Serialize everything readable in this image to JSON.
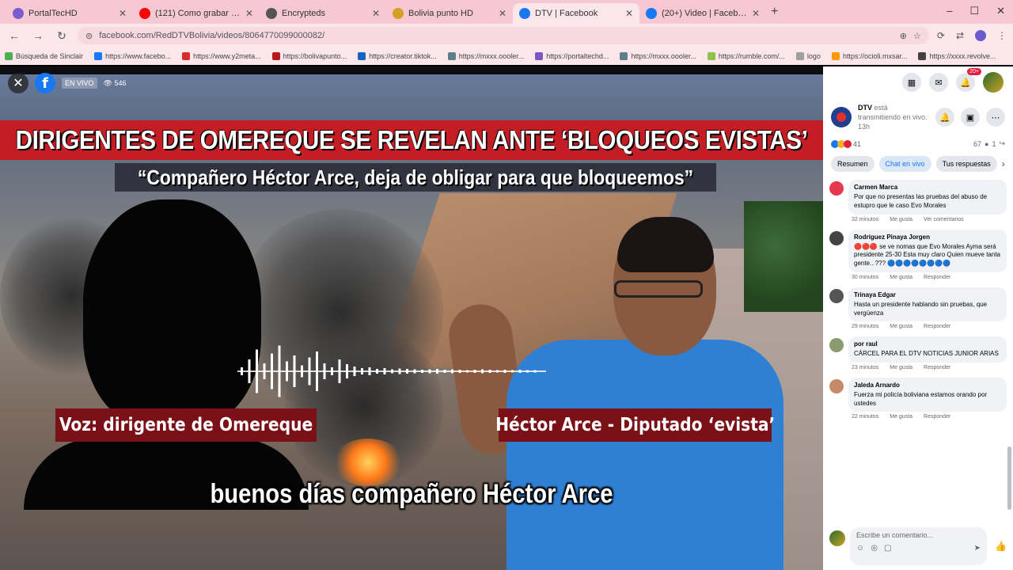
{
  "browser": {
    "tabs": [
      {
        "title": "PortalTecHD",
        "color": "#7a5ccf",
        "active": false
      },
      {
        "title": "(121) Como grabar la pantalla",
        "color": "#ff0000",
        "active": false
      },
      {
        "title": "Encrypteds",
        "color": "#555555",
        "active": false
      },
      {
        "title": "Bolivia punto HD",
        "color": "#d4a020",
        "active": false
      },
      {
        "title": "DTV | Facebook",
        "color": "#1877f2",
        "active": true
      },
      {
        "title": "(20+) Video | Facebook",
        "color": "#1877f2",
        "active": false
      }
    ],
    "url": "facebook.com/RedDTVBolivia/videos/8064770099000082/",
    "bookmarks": [
      {
        "label": "Búsqueda de Sinclair",
        "color": "#4caf50"
      },
      {
        "label": "https://www.facebo...",
        "color": "#1877f2"
      },
      {
        "label": "https://www.y2meta...",
        "color": "#d32f2f"
      },
      {
        "label": "https://bolivapunto...",
        "color": "#b71c1c"
      },
      {
        "label": "https://creator.tiktok...",
        "color": "#1565c0"
      },
      {
        "label": "https://mxxx.oooler...",
        "color": "#607d8b"
      },
      {
        "label": "https://portaltechd...",
        "color": "#7e57c2"
      },
      {
        "label": "https://mxxx.oooler...",
        "color": "#607d8b"
      },
      {
        "label": "https://rumble.com/...",
        "color": "#8bc34a"
      },
      {
        "label": "logo",
        "color": "#9e9e9e"
      },
      {
        "label": "https://ocioli.mxsar...",
        "color": "#ff9800"
      },
      {
        "label": "https://xxxx.revolve...",
        "color": "#424242"
      }
    ]
  },
  "video": {
    "views": "546",
    "badge": "EN VIVO",
    "title_banner": "DIRIGENTES DE OMEREQUE SE REVELAN ANTE ‘BLOQUEOS EVISTAS’",
    "subtitle_banner": "“Compañero Héctor Arce, deja de obligar para que bloqueemos”",
    "caption_left": "Voz: dirigente de Omereque",
    "caption_right": "Héctor Arce - Diputado ‘evista’",
    "live_caption": "buenos días compañero Héctor Arce"
  },
  "panel": {
    "notif_count": "20+",
    "page_name": "DTV",
    "page_status": "está transmitiendo en vivo.",
    "time_ago": "13h",
    "reaction_count": "41",
    "comments_count": "67",
    "shares_count": "1",
    "tabs": [
      "Resumen",
      "Chat en vivo",
      "Tus respuestas"
    ],
    "comments": [
      {
        "name": "Carmen Marca",
        "text": "Por que no presentas las pruebas del abuso de estupro que le caso Evo Morales",
        "time": "32 minutos",
        "like": "Me gusta",
        "reply": "Ver comentarios",
        "color": "#e53950"
      },
      {
        "name": "Rodríguez Pinaya Jorgen",
        "text": "🔴🔴🔴 se ve nomas que Evo Morales Ayma será presidente 25-30 Esta muy claro Quien mueve tanta gente.. ???  🔵🔵🔵🔵🔵🔵🔵🔵",
        "time": "30 minutos",
        "like": "Me gusta",
        "reply": "Responder",
        "color": "#444444"
      },
      {
        "name": "Trinaya Edgar",
        "text": "Hasta un presidente hablando sin pruebas, que vergüenza",
        "time": "29 minutos",
        "like": "Me gusta",
        "reply": "Responder",
        "color": "#555555"
      },
      {
        "name": "por raul",
        "text": "CÁRCEL PARA EL DTV NOTICIAS JUNIOR ARIAS",
        "time": "23 minutos",
        "like": "Me gusta",
        "reply": "Responder",
        "color": "#8a9b6e"
      },
      {
        "name": "Jaleda Arnardo",
        "text": "Fuerza mi policía boliviana estamos orando por ustedes",
        "time": "22 minutos",
        "like": "Me gusta",
        "reply": "Responder",
        "color": "#c48a6a"
      }
    ],
    "composer_placeholder": "Escribe un comentario..."
  }
}
